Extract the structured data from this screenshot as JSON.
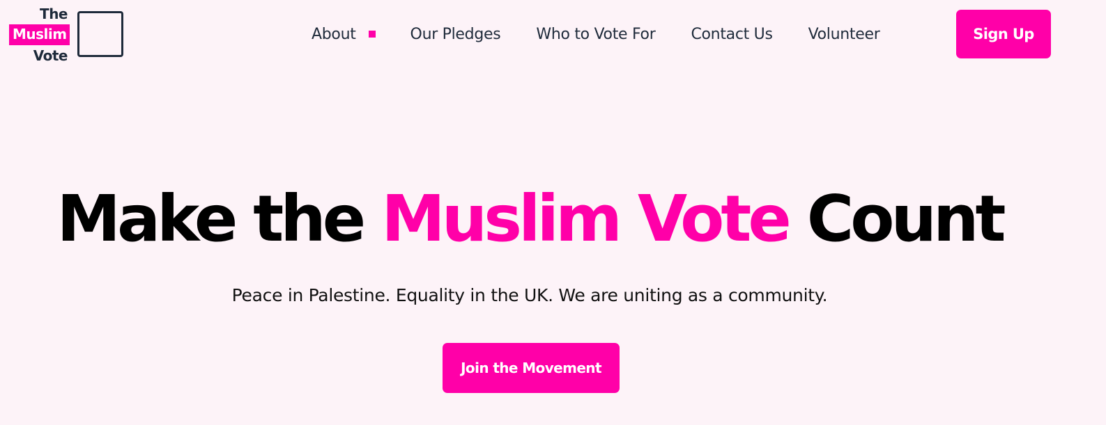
{
  "logo": {
    "line1": "The",
    "line2": "Muslim",
    "line3": "Vote"
  },
  "nav": {
    "items": [
      {
        "label": "About"
      },
      {
        "label": "Our Pledges"
      },
      {
        "label": "Who to Vote For"
      },
      {
        "label": "Contact Us"
      },
      {
        "label": "Volunteer"
      }
    ],
    "signup_label": "Sign Up"
  },
  "hero": {
    "title_part1": "Make the ",
    "title_accent": "Muslim Vote",
    "title_part2": " Count",
    "subtitle": "Peace in Palestine. Equality in the UK. We are uniting as a community.",
    "cta_label": "Join the Movement"
  },
  "colors": {
    "accent": "#ff00a8",
    "background": "#fdf3f8",
    "text_dark": "#1e2a3a"
  }
}
